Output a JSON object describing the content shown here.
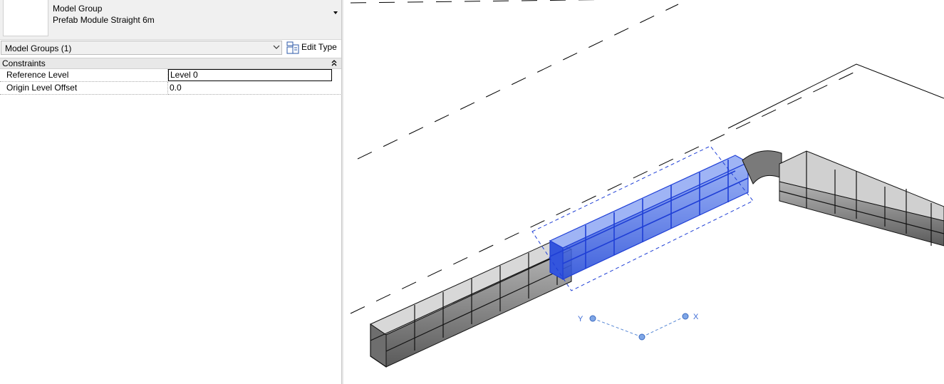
{
  "properties": {
    "type_selector": {
      "family": "Model Group",
      "type": "Prefab Module Straight 6m"
    },
    "filter": {
      "label": "Model Groups (1)",
      "edit_type_label": "Edit Type"
    },
    "groups": [
      {
        "title": "Constraints",
        "rows": [
          {
            "name": "Reference Level",
            "value": "Level 0"
          },
          {
            "name": "Origin Level Offset",
            "value": "0.0"
          }
        ]
      }
    ]
  },
  "viewport": {
    "axes": {
      "x_label": "X",
      "y_label": "Y"
    },
    "colors": {
      "selection": "#1f3fd6",
      "axis_dot": "#5a8ad6",
      "module_fill": "#8a8a8a"
    }
  }
}
